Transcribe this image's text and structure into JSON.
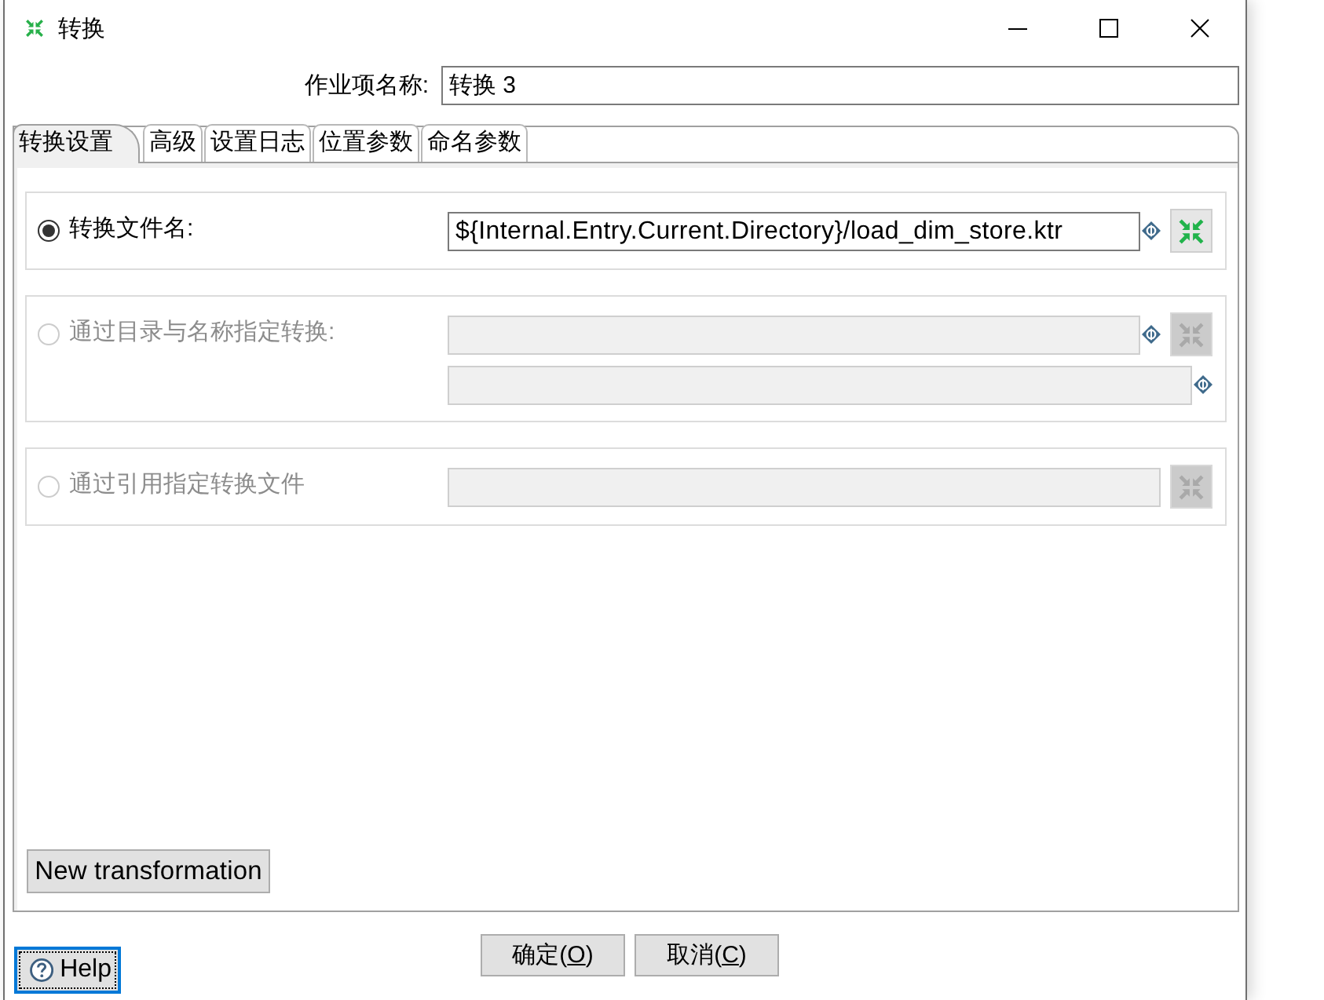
{
  "window": {
    "title": "转换"
  },
  "job_name": {
    "label": "作业项名称:",
    "value": "转换 3"
  },
  "tabs": [
    {
      "label": "转换设置",
      "selected": true
    },
    {
      "label": "高级",
      "selected": false
    },
    {
      "label": "设置日志",
      "selected": false
    },
    {
      "label": "位置参数",
      "selected": false
    },
    {
      "label": "命名参数",
      "selected": false
    }
  ],
  "options": [
    {
      "label": "转换文件名:",
      "selected": true,
      "disabled": false,
      "fields": [
        {
          "value": "${Internal.Entry.Current.Directory}/load_dim_store.ktr",
          "variable": true,
          "browse": true
        }
      ]
    },
    {
      "label": "通过目录与名称指定转换:",
      "selected": false,
      "disabled": true,
      "fields": [
        {
          "variable": true,
          "browse": true
        },
        {
          "variable": true,
          "browse": false
        }
      ]
    },
    {
      "label": "通过引用指定转换文件",
      "selected": false,
      "disabled": true,
      "fields": [
        {
          "variable": false,
          "browse": true
        }
      ]
    }
  ],
  "new_transformation_button": {
    "label": "New transformation"
  },
  "help_button": {
    "label": "Help",
    "focused": true
  },
  "dialog_buttons": [
    {
      "label_before": "确定(",
      "mnemonic": "O",
      "label_after": ")"
    },
    {
      "label_before": "取消(",
      "mnemonic": "C",
      "label_after": ")"
    }
  ]
}
